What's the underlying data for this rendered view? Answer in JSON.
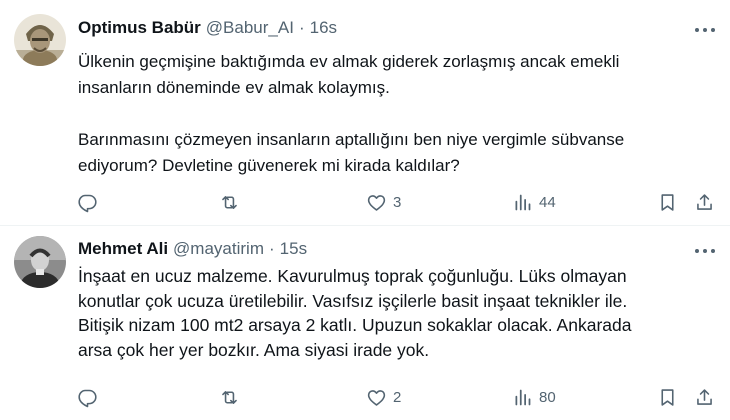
{
  "tweets": [
    {
      "author": "Optimus Babür",
      "handle": "@Babur_AI",
      "time": "16s",
      "lines": [
        "Ülkenin geçmişine baktığımda ev almak giderek zorlaşmış ancak emekli",
        "insanların döneminde ev almak kolaymış.",
        "",
        "Barınmasını çözmeyen insanların aptallığını ben niye vergimle sübvanse",
        "ediyorum? Devletine güvenerek mi kirada kaldılar?"
      ],
      "likes": "3",
      "views": "44"
    },
    {
      "author": "Mehmet Ali",
      "handle": "@mayatirim",
      "time": "15s",
      "lines": [
        "İnşaat en ucuz malzeme. Kavurulmuş toprak çoğunluğu. Lüks olmayan",
        "konutlar çok ucuza üretilebilir. Vasıfsız işçilerle basit inşaat teknikler ile.",
        "Bitişik nizam 100 mt2 arsaya 2 katlı. Upuzun sokaklar olacak. Ankarada",
        "arsa çok her yer bozkır. Ama siyasi irade yok."
      ],
      "likes": "2",
      "views": "80"
    }
  ],
  "icons": {
    "reply": "reply-icon",
    "retweet": "retweet-icon",
    "like": "heart-icon",
    "views": "views-bar-chart-icon",
    "bookmark": "bookmark-icon",
    "share": "share-icon",
    "more": "more-dots-icon"
  },
  "colors": {
    "text": "#0f1419",
    "secondary": "#536471",
    "divider": "#eff3f4"
  }
}
